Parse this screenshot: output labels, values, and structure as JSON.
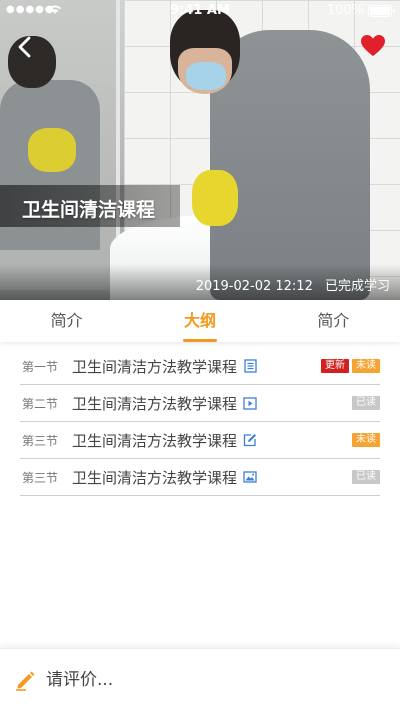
{
  "status_bar": {
    "signal": "●●●●●",
    "wifi_icon": "wifi-icon",
    "time": "9:41 AM",
    "battery_percent": "100%"
  },
  "hero": {
    "title": "卫生间清洁课程",
    "date": "2019-02-02 12:12",
    "status": "已完成学习",
    "back_icon": "chevron-left-icon",
    "favorite_icon": "heart-icon",
    "favorite_color": "#e0202b"
  },
  "tabs": [
    {
      "label": "简介",
      "active": false
    },
    {
      "label": "大纲",
      "active": true
    },
    {
      "label": "简介",
      "active": false
    }
  ],
  "colors": {
    "accent": "#f39a1e",
    "badge_new": "#d21f1f",
    "badge_unread": "#f5a434",
    "badge_read": "#c8c8c8",
    "icon_blue": "#3d7fd6"
  },
  "sections": [
    {
      "section": "第一节",
      "title": "卫生间清洁方法教学课程",
      "icon": "document-icon",
      "badges": [
        {
          "text": "更新",
          "kind": "new"
        },
        {
          "text": "未读",
          "kind": "unread"
        }
      ]
    },
    {
      "section": "第二节",
      "title": "卫生间清洁方法教学课程",
      "icon": "video-play-icon",
      "badges": [
        {
          "text": "已读",
          "kind": "read"
        }
      ]
    },
    {
      "section": "第三节",
      "title": "卫生间清洁方法教学课程",
      "icon": "edit-icon",
      "badges": [
        {
          "text": "未读",
          "kind": "unread"
        }
      ]
    },
    {
      "section": "第三节",
      "title": "卫生间清洁方法教学课程",
      "icon": "image-icon",
      "badges": [
        {
          "text": "已读",
          "kind": "read"
        }
      ]
    }
  ],
  "comment": {
    "placeholder": "请评价...",
    "icon": "pencil-icon"
  }
}
